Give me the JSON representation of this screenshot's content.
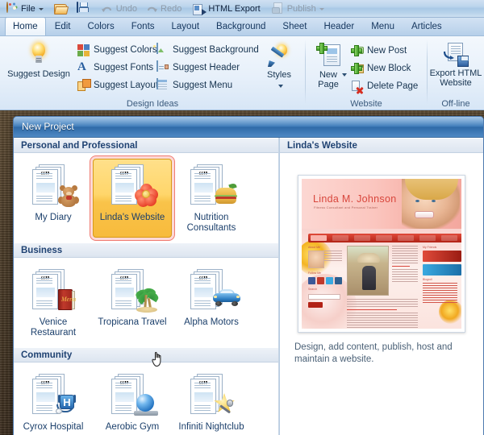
{
  "quick_access": {
    "items": [
      {
        "label": "File",
        "icon": "palette-icon",
        "has_caret": true,
        "enabled": true
      },
      {
        "label": "",
        "icon": "open-folder-icon",
        "has_caret": false,
        "enabled": true
      },
      {
        "label": "",
        "icon": "save-floppy-icon",
        "has_caret": false,
        "enabled": true
      },
      {
        "label": "Undo",
        "icon": "undo-arrow-icon",
        "has_caret": false,
        "enabled": false
      },
      {
        "label": "Redo",
        "icon": "redo-arrow-icon",
        "has_caret": false,
        "enabled": false
      },
      {
        "label": "HTML Export",
        "icon": "html-export-icon",
        "has_caret": false,
        "enabled": true
      },
      {
        "label": "Publish",
        "icon": "publish-icon",
        "has_caret": true,
        "enabled": false
      }
    ]
  },
  "ribbon": {
    "tabs": [
      {
        "label": "Home",
        "active": true
      },
      {
        "label": "Edit",
        "active": false
      },
      {
        "label": "Colors",
        "active": false
      },
      {
        "label": "Fonts",
        "active": false
      },
      {
        "label": "Layout",
        "active": false
      },
      {
        "label": "Background",
        "active": false
      },
      {
        "label": "Sheet",
        "active": false
      },
      {
        "label": "Header",
        "active": false
      },
      {
        "label": "Menu",
        "active": false
      },
      {
        "label": "Articles",
        "active": false
      }
    ],
    "groups": [
      {
        "title": "Design Ideas",
        "big_buttons": [
          {
            "label": "Suggest Design",
            "icon": "lightbulb-icon"
          },
          {
            "label": "Styles",
            "icon": "lightbulb-brush-icon",
            "has_caret": true
          }
        ],
        "small_buttons": [
          {
            "label": "Suggest Colors",
            "icon": "color-swatches-icon"
          },
          {
            "label": "Suggest Fonts",
            "icon": "font-letter-a-icon"
          },
          {
            "label": "Suggest Layout",
            "icon": "layout-blocks-icon"
          },
          {
            "label": "Suggest Background",
            "icon": "background-picture-icon"
          },
          {
            "label": "Suggest Header",
            "icon": "header-banner-icon"
          },
          {
            "label": "Suggest Menu",
            "icon": "menu-list-icon"
          }
        ]
      },
      {
        "title": "Website",
        "big_buttons": [
          {
            "label": "New Page",
            "icon": "new-page-icon",
            "has_caret": true
          }
        ],
        "small_buttons": [
          {
            "label": "New Post",
            "icon": "new-post-icon"
          },
          {
            "label": "New Block",
            "icon": "new-block-icon"
          },
          {
            "label": "Delete Page",
            "icon": "delete-page-icon"
          }
        ]
      },
      {
        "title": "Off-line",
        "big_buttons": [
          {
            "label": "Export HTML Website",
            "icon": "export-html-website-icon"
          }
        ],
        "small_buttons": []
      }
    ]
  },
  "dialog": {
    "title": "New Project",
    "categories": [
      {
        "name": "Personal and Professional",
        "templates": [
          {
            "label": "My Diary",
            "icon": "teddy-bear-icon",
            "selected": false
          },
          {
            "label": "Linda's Website",
            "icon": "red-flower-icon",
            "selected": true
          },
          {
            "label": "Nutrition Consultants",
            "icon": "burger-icon",
            "selected": false
          }
        ]
      },
      {
        "name": "Business",
        "templates": [
          {
            "label": "Venice Restaurant",
            "icon": "menu-book-icon",
            "selected": false
          },
          {
            "label": "Tropicana Travel",
            "icon": "palm-tree-icon",
            "selected": false
          },
          {
            "label": "Alpha Motors",
            "icon": "blue-car-icon",
            "selected": false
          }
        ]
      },
      {
        "name": "Community",
        "templates": [
          {
            "label": "Cyrox Hospital",
            "icon": "hospital-stethoscope-icon",
            "selected": false
          },
          {
            "label": "Aerobic Gym",
            "icon": "exercise-ball-icon",
            "selected": false
          },
          {
            "label": "Infiniti Nightclub",
            "icon": "star-microphone-icon",
            "selected": false
          }
        ]
      }
    ],
    "preview": {
      "header": "Linda's Website",
      "site_title": "Linda M. Johnson",
      "site_subtitle": "Fitness Consultant and Personal Trainer",
      "description": "Design, add content, publish, host and maintain a website."
    }
  },
  "colors": {
    "accent": "#2f6aa8",
    "selection_fill": "#ffd66b",
    "selection_outline": "#f07b72",
    "ribbon_text": "#16334f"
  }
}
